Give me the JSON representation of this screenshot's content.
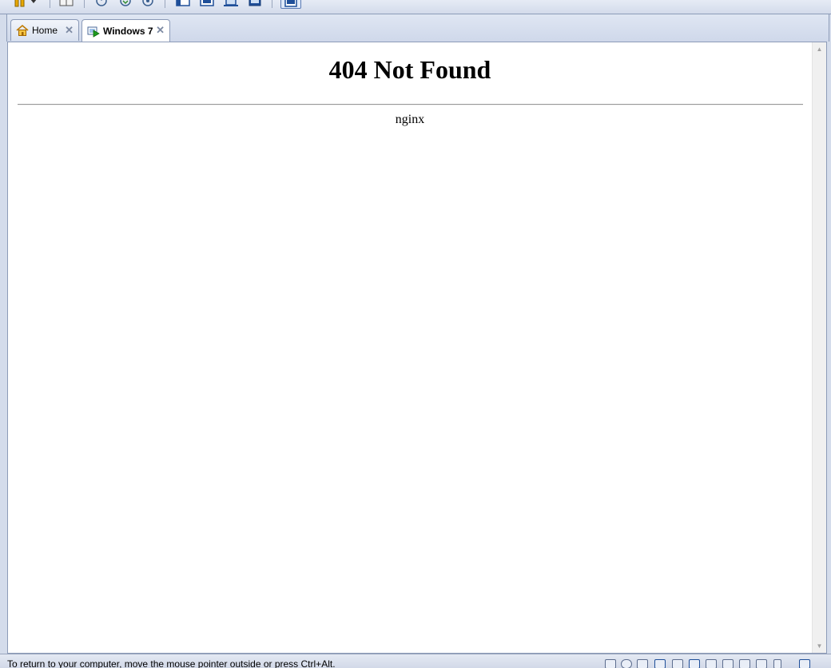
{
  "toolbar": {
    "icons": [
      "pause-icon",
      "dropdown-arrow-icon",
      "settings-icon",
      "snapshot-icon",
      "revert-snapshot-icon",
      "snapshot-manager-icon",
      "normal-view-icon",
      "fullscreen-icon",
      "unity-icon",
      "console-view-icon",
      "thumbnail-bar-icon"
    ]
  },
  "tabs": [
    {
      "label": "Home",
      "icon": "home-icon",
      "active": false
    },
    {
      "label": "Windows 7",
      "icon": "vm-running-icon",
      "active": true
    }
  ],
  "page": {
    "heading": "404 Not Found",
    "server": "nginx"
  },
  "status": {
    "text": "To return to your computer, move the mouse pointer outside or press Ctrl+Alt.",
    "device_icons": [
      "hard-disk-icon",
      "cd-dvd-icon",
      "floppy-icon",
      "network-adapter-icon",
      "printer-icon",
      "sound-card-icon",
      "usb-device-icon",
      "display-icon",
      "removable-device-icon",
      "usb-controller-icon",
      "messages-icon"
    ]
  },
  "colors": {
    "chrome": "#d4dceb",
    "accent": "#2f5ea8",
    "page_bg": "#ffffff"
  }
}
